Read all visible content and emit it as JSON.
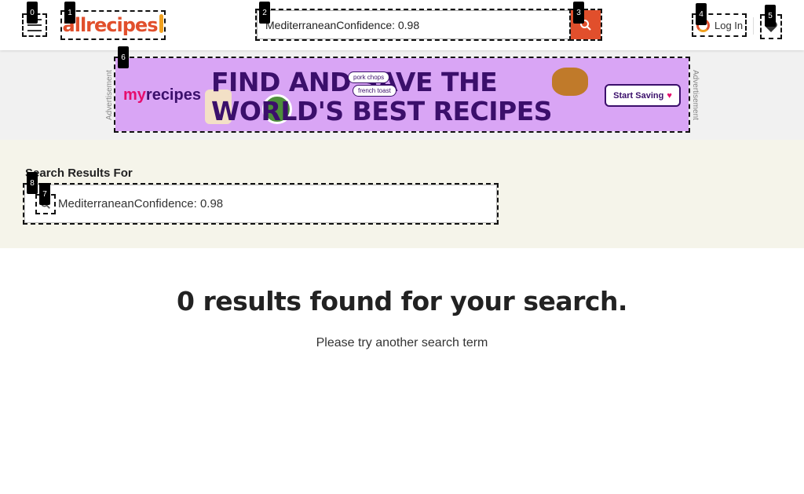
{
  "header": {
    "logo_text": "allrecipes",
    "search_value": "MediterraneanConfidence: 0.98",
    "login_label": "Log In"
  },
  "ad": {
    "label": "Advertisement",
    "brand_my": "my",
    "brand_recipes": "recipes",
    "headline_line1": "FIND AND SAVE THE",
    "headline_line2": "WORLD'S BEST RECIPES",
    "chip_1": "pork chops",
    "chip_2": "french toast",
    "cta": "Start Saving"
  },
  "results": {
    "title": "Search Results For",
    "query_value": "MediterraneanConfidence: 0.98"
  },
  "empty_state": {
    "heading": "0 results found for your search.",
    "subtext": "Please try another search term"
  },
  "markers": [
    "0",
    "1",
    "2",
    "3",
    "4",
    "5",
    "6",
    "7",
    "8"
  ],
  "colors": {
    "brand_orange": "#e14f2c",
    "ad_background": "#d9a5f5",
    "results_band": "#f5f4ea"
  }
}
